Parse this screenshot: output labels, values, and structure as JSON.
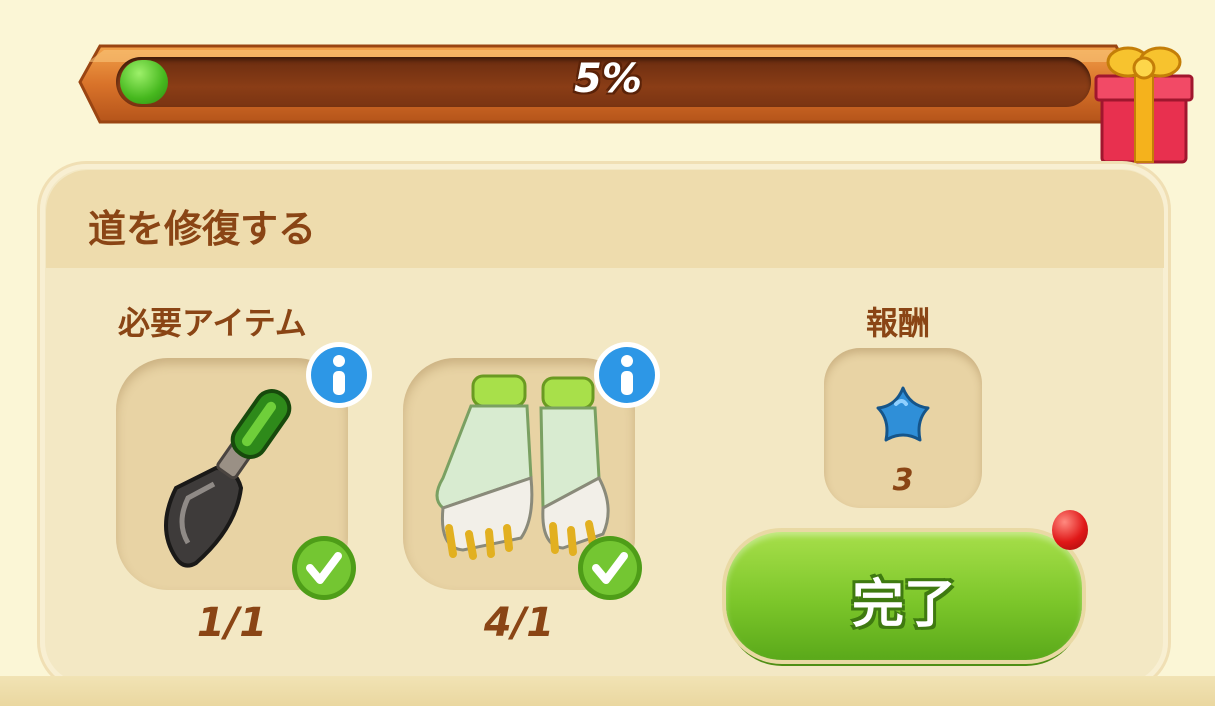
{
  "progress": {
    "percent": 5,
    "label": "5%"
  },
  "quest": {
    "title": "道を修復する"
  },
  "required": {
    "label": "必要アイテム",
    "items": [
      {
        "name": "trowel",
        "count": "1/1",
        "complete": true
      },
      {
        "name": "gloves",
        "count": "4/1",
        "complete": true
      }
    ]
  },
  "reward": {
    "label": "報酬",
    "icon": "blue-star-icon",
    "amount": "3"
  },
  "complete_button": {
    "label": "完了",
    "has_notification": true
  },
  "colors": {
    "accent_green": "#7cc62a",
    "text_brown": "#8a4515",
    "background": "#fbf6d6"
  }
}
